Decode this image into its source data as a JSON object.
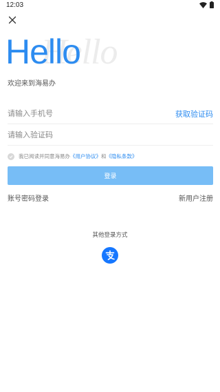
{
  "status_bar": {
    "time": "12:03",
    "icons": [
      "wifi-icon",
      "battery-icon"
    ]
  },
  "header": {
    "close_icon": "close-icon"
  },
  "hero": {
    "title": "Hello",
    "ghost_title": "Hello",
    "welcome": "欢迎来到海易办"
  },
  "form": {
    "phone_placeholder": "请输入手机号",
    "get_code_label": "获取验证码",
    "code_placeholder": "请输入验证码"
  },
  "agreement": {
    "prefix": "我已阅读并同意海易办",
    "user_agreement": "《用户协议》",
    "connector": "和",
    "privacy_policy": "《隐私条款》"
  },
  "login_button": "登录",
  "links": {
    "password_login": "账号密码登录",
    "register": "新用户注册"
  },
  "other_login": {
    "title": "其他登录方式",
    "alipay_icon": "alipay-icon"
  },
  "colors": {
    "accent": "#2d8cf0",
    "button": "#77bdf6",
    "alipay": "#1677ff"
  }
}
